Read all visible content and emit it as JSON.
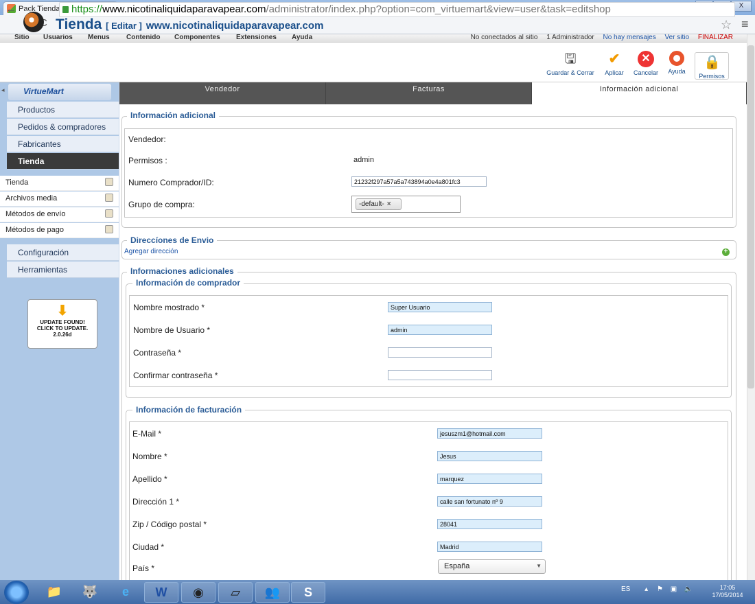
{
  "browser": {
    "tab_title": "Pack Tienda Boutique - Ac",
    "url_scheme": "https://",
    "url_domain": "www.nicotinaliquidaparavapear.com",
    "url_path": "/administrator/index.php?option=com_virtuemart&view=user&task=editshop",
    "win_minimize": "–",
    "win_restore": "▭",
    "win_close": "X"
  },
  "topmenu": {
    "items": [
      "Sitio",
      "Usuarios",
      "Menus",
      "Contenido",
      "Componentes",
      "Extensiones",
      "Ayuda"
    ],
    "status": {
      "offline": "No conectados al sitio",
      "admin": "1 Administrador",
      "messages": "No hay mensajes",
      "view_site": "Ver sitio",
      "logout": "FINALIZAR"
    }
  },
  "header": {
    "title": "Tienda",
    "edit": "[ Editar ]",
    "site": "www.nicotinaliquidaparavapear.com"
  },
  "toolbar": {
    "save_close": "Guardar & Cerrar",
    "apply": "Aplicar",
    "cancel": "Cancelar",
    "help": "Ayuda",
    "permissions": "Permisos"
  },
  "sidebar": {
    "logo": "VirtueMart",
    "items": [
      "Productos",
      "Pedidos & compradores",
      "Fabricantes",
      "Tienda"
    ],
    "subitems": [
      "Tienda",
      "Archivos media",
      "Métodos de envío",
      "Métodos de pago"
    ],
    "items2": [
      "Configuración",
      "Herramientas"
    ],
    "update": {
      "line1": "UPDATE FOUND!",
      "line2": "CLICK TO UPDATE.",
      "version": "2.0.26d"
    }
  },
  "tabs": [
    "Vendedor",
    "Facturas",
    "Información adicional"
  ],
  "info": {
    "legend": "Información adicional",
    "vendor_label": "Vendedor:",
    "perms_label": "Permisos :",
    "perms_value": "admin",
    "buyer_id_label": "Numero Comprador/ID:",
    "buyer_id_value": "21232f297a57a5a743894a0e4a801fc3",
    "group_label": "Grupo de compra:",
    "group_chip": "-default-",
    "group_chip_x": "×"
  },
  "shipping": {
    "legend": "Direccíones de Envio",
    "add_link": "Agregar dirección",
    "add_icon": "+"
  },
  "extra": {
    "legend": "Informaciones adicionales",
    "buyer": {
      "legend": "Información de comprador",
      "display_name_label": "Nombre mostrado *",
      "display_name": "Super Usuario",
      "username_label": "Nombre de Usuario *",
      "username": "admin",
      "password_label": "Contraseña *",
      "password": "",
      "confirm_label": "Confirmar contraseña *",
      "confirm": ""
    },
    "billing": {
      "legend": "Información de facturación",
      "email_label": "E-Mail *",
      "email": "jesuszm1@hotmail.com",
      "name_label": "Nombre *",
      "name": "Jesus",
      "surname_label": "Apellido *",
      "surname": "marquez",
      "address_label": "Dirección 1 *",
      "address": "calle san fortunato nº 9",
      "zip_label": "Zip / Código postal *",
      "zip": "28041",
      "city_label": "Ciudad *",
      "city": "Madrid",
      "country_label": "País *",
      "country": "España"
    }
  },
  "taskbar": {
    "lang": "ES",
    "time": "17:05",
    "date": "17/05/2014"
  }
}
